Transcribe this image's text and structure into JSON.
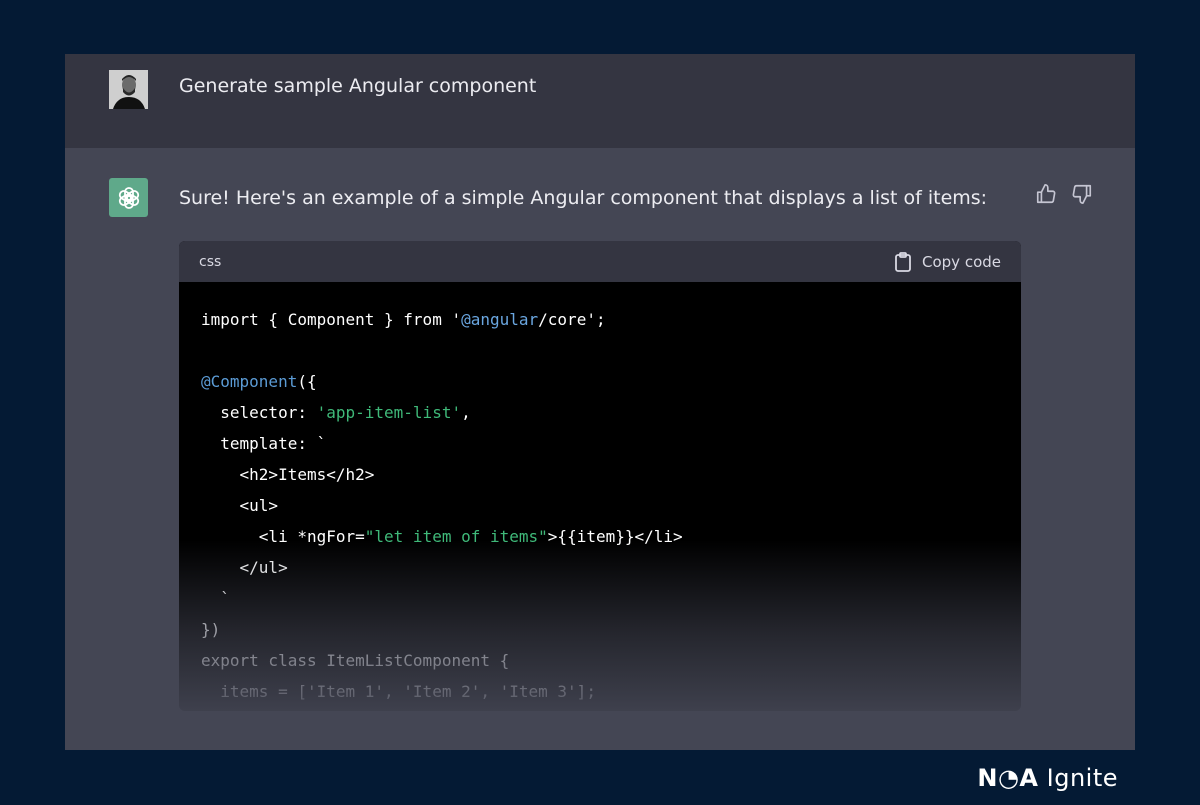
{
  "user": {
    "message": "Generate sample Angular component",
    "avatar_icon": "user-avatar"
  },
  "assistant": {
    "icon": "openai-logo-icon",
    "message": "Sure! Here's an example of a simple Angular component that displays a list of items:",
    "feedback": {
      "up_icon": "thumbs-up-icon",
      "down_icon": "thumbs-down-icon"
    }
  },
  "code_block": {
    "language": "css",
    "copy_label": "Copy code",
    "copy_icon": "clipboard-icon",
    "lines": [
      [
        {
          "t": "import { Component } from '",
          "c": "kw"
        },
        {
          "t": "@angular",
          "c": "at"
        },
        {
          "t": "/core';",
          "c": "kw"
        }
      ],
      [],
      [
        {
          "t": "@Component",
          "c": "deco"
        },
        {
          "t": "({",
          "c": "kw"
        }
      ],
      [
        {
          "t": "  selector: ",
          "c": "kw"
        },
        {
          "t": "'app-item-list'",
          "c": "str"
        },
        {
          "t": ",",
          "c": "kw"
        }
      ],
      [
        {
          "t": "  template: `",
          "c": "kw"
        }
      ],
      [
        {
          "t": "    <h2>Items</h2>",
          "c": "kw"
        }
      ],
      [
        {
          "t": "    <ul>",
          "c": "kw"
        }
      ],
      [
        {
          "t": "      <li *ngFor=",
          "c": "kw"
        },
        {
          "t": "\"let item of items\"",
          "c": "str"
        },
        {
          "t": ">{{item}}</li>",
          "c": "kw"
        }
      ],
      [
        {
          "t": "    </ul>",
          "c": "kw"
        }
      ],
      [
        {
          "t": "  `",
          "c": "kw"
        }
      ],
      [
        {
          "t": "})",
          "c": "kw"
        }
      ],
      [
        {
          "t": "export class ItemListComponent {",
          "c": "kw"
        }
      ],
      [
        {
          "t": "  items = ['Item 1', 'Item 2', 'Item 3'];",
          "c": "kw"
        }
      ]
    ]
  },
  "brand": {
    "strong": "N◔A",
    "light": " Ignite"
  },
  "colors": {
    "background": "#041a34",
    "panel": "#444654",
    "user_row": "#343541",
    "bot_icon": "#5fa98a"
  }
}
